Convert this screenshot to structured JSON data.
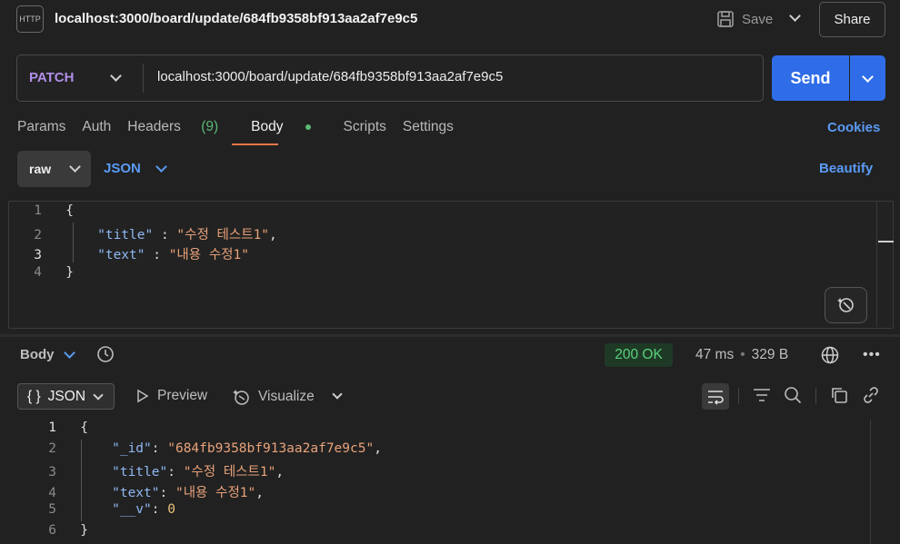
{
  "header": {
    "http_icon_text": "HTTP",
    "tab_title": "localhost:3000/board/update/684fb9358bf913aa2af7e9c5",
    "save_label": "Save",
    "share_label": "Share"
  },
  "request": {
    "method": "PATCH",
    "url": "localhost:3000/board/update/684fb9358bf913aa2af7e9c5",
    "send_label": "Send"
  },
  "request_tabs": {
    "params": "Params",
    "auth": "Auth",
    "headers": "Headers",
    "headers_count": "(9)",
    "body": "Body",
    "scripts": "Scripts",
    "settings": "Settings",
    "cookies": "Cookies"
  },
  "body_options": {
    "mode": "raw",
    "language": "JSON",
    "beautify": "Beautify"
  },
  "request_body": {
    "lines": [
      {
        "n": "1",
        "text": "{"
      },
      {
        "n": "2",
        "key": "\"title\"",
        "sep": " : ",
        "value": "\"수정 테스트1\"",
        "end": ","
      },
      {
        "n": "3",
        "key": "\"text\"",
        "sep": " : ",
        "value": "\"내용 수정1\"",
        "end": ""
      },
      {
        "n": "4",
        "text": "}"
      }
    ]
  },
  "response": {
    "section_label": "Body",
    "status": "200 OK",
    "time": "47 ms",
    "size": "329 B",
    "more": "•••",
    "format_label": "JSON",
    "format_icon": "{ }",
    "preview_label": "Preview",
    "visualize_label": "Visualize",
    "lines": [
      {
        "n": "1",
        "text": "{"
      },
      {
        "n": "2",
        "key": "\"_id\"",
        "sep": ": ",
        "value": "\"684fb9358bf913aa2af7e9c5\"",
        "end": ","
      },
      {
        "n": "3",
        "key": "\"title\"",
        "sep": ": ",
        "value": "\"수정 테스트1\"",
        "end": ","
      },
      {
        "n": "4",
        "key": "\"text\"",
        "sep": ": ",
        "value": "\"내용 수정1\"",
        "end": ","
      },
      {
        "n": "5",
        "key": "\"__v\"",
        "sep": ": ",
        "value": "0",
        "end": ""
      },
      {
        "n": "6",
        "text": "}"
      }
    ]
  },
  "colors": {
    "accent": "#2f6de8",
    "method": "#b08ee8",
    "status_ok": "#5bd17a",
    "link": "#5a9bf5"
  }
}
